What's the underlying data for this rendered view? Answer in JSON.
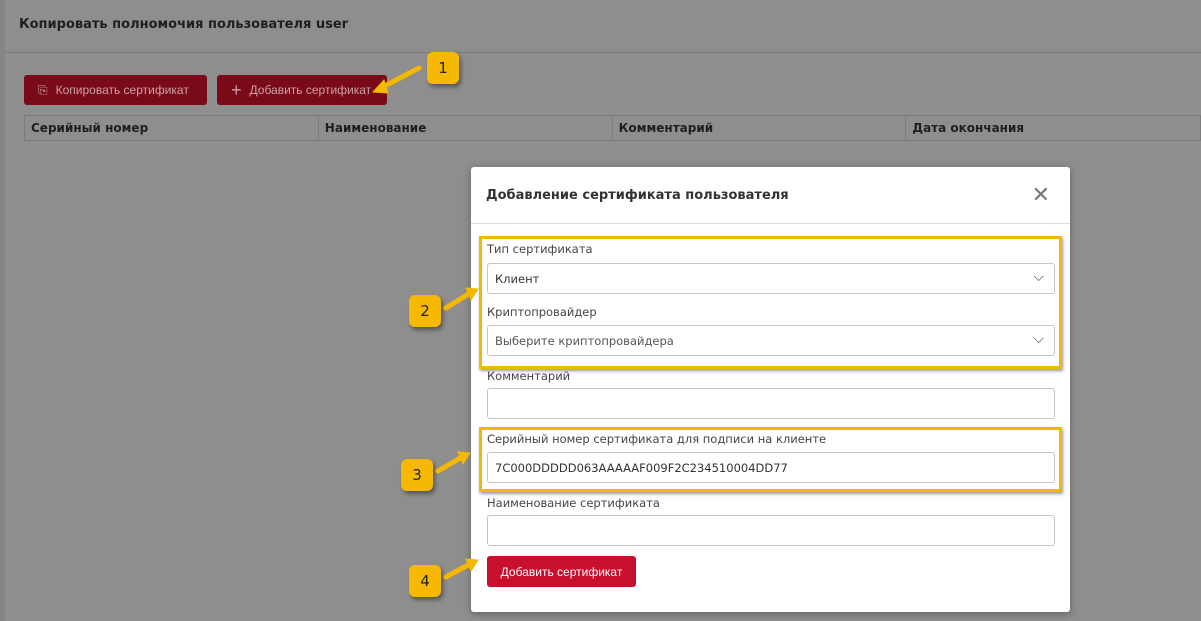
{
  "page": {
    "title": "Копировать полномочия пользователя user",
    "copy_button": "Копировать сертификат",
    "add_button": "Добавить сертификат",
    "columns": [
      "Серийный номер",
      "Наименование",
      "Комментарий",
      "Дата окончания"
    ]
  },
  "modal": {
    "title": "Добавление сертификата пользователя",
    "cert_type_label": "Тип сертификата",
    "cert_type_value": "Клиент",
    "crypto_label": "Криптопровайдер",
    "crypto_placeholder": "Выберите криптопровайдера",
    "comment_label": "Комментарий",
    "comment_value": "",
    "serial_label": "Серийный номер сертификата для подписи на клиенте",
    "serial_value": "7C000DDDDD063AAAAAF009F2C234510004DD77",
    "name_label": "Наименование сертификата",
    "name_value": "",
    "submit": "Добавить сертификат"
  },
  "callouts": [
    "1",
    "2",
    "3",
    "4"
  ],
  "colors": {
    "primary": "#c8102e",
    "highlight": "#f5b800"
  }
}
